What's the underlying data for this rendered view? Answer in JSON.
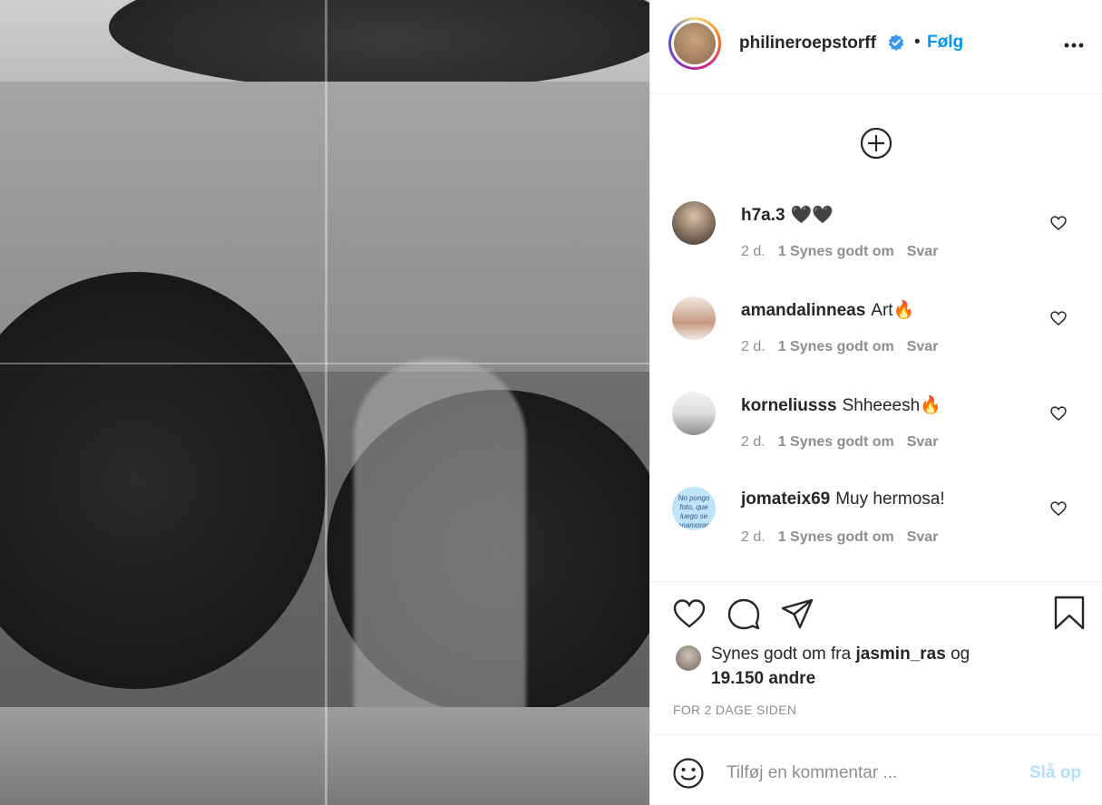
{
  "post": {
    "photo_alt": "Post photo"
  },
  "header": {
    "username": "philineroepstorff",
    "follow_label": "Følg",
    "separator": "•"
  },
  "comments": [
    {
      "user": "h7a.3",
      "text": "🖤🖤",
      "age": "2 d.",
      "likes": "1 Synes godt om",
      "reply": "Svar"
    },
    {
      "user": "amandalinneas",
      "text": "Art🔥",
      "age": "2 d.",
      "likes": "1 Synes godt om",
      "reply": "Svar"
    },
    {
      "user": "korneliusss",
      "text": "Shheeesh🔥",
      "age": "2 d.",
      "likes": "1 Synes godt om",
      "reply": "Svar"
    },
    {
      "user": "jomateix69",
      "text": "Muy hermosa!",
      "age": "2 d.",
      "likes": "1 Synes godt om",
      "reply": "Svar",
      "avatar_text": "No pongo foto, que luego se enamoran"
    }
  ],
  "likes": {
    "prefix": "Synes godt om fra",
    "user": "jasmin_ras",
    "conjunction": "og",
    "others": "19.150 andre"
  },
  "timestamp": "FOR 2 DAGE SIDEN",
  "add_comment": {
    "placeholder": "Tilføj en kommentar ...",
    "post_label": "Slå op"
  },
  "colors": {
    "accent": "#0095f6",
    "post_disabled": "#b2dffc",
    "muted": "#8e8e8e"
  },
  "icons": [
    "verified-badge-icon",
    "more-options-icon",
    "load-more-comments-icon",
    "heart-icon",
    "comment-icon",
    "share-icon",
    "bookmark-icon",
    "emoji-icon"
  ]
}
